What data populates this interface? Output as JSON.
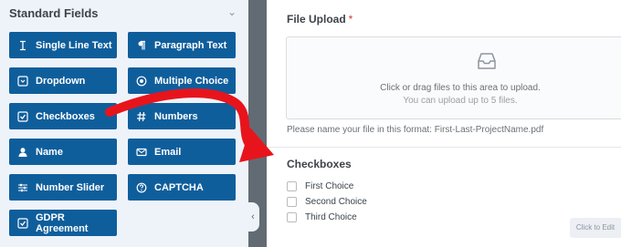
{
  "sidebar": {
    "section_title": "Standard Fields",
    "collapse_icon": "chevron-up-icon",
    "fields": [
      {
        "label": "Single Line Text",
        "icon": "text-cursor-icon"
      },
      {
        "label": "Paragraph Text",
        "icon": "paragraph-icon"
      },
      {
        "label": "Dropdown",
        "icon": "dropdown-icon"
      },
      {
        "label": "Multiple Choice",
        "icon": "radio-icon"
      },
      {
        "label": "Checkboxes",
        "icon": "checkbox-icon"
      },
      {
        "label": "Numbers",
        "icon": "hash-icon"
      },
      {
        "label": "Name",
        "icon": "user-icon"
      },
      {
        "label": "Email",
        "icon": "envelope-icon"
      },
      {
        "label": "Number Slider",
        "icon": "sliders-icon"
      },
      {
        "label": "CAPTCHA",
        "icon": "question-circle-icon"
      },
      {
        "label": "GDPR Agreement",
        "icon": "checkbox-icon"
      }
    ],
    "button_color": "#0f5e9c",
    "panel_bg": "#eef3f9"
  },
  "gutter": {
    "handle_icon": "chevron-left-icon",
    "color": "#626b74"
  },
  "form": {
    "file_upload": {
      "label": "File Upload",
      "required_mark": "*",
      "dropzone_icon": "inbox-icon",
      "dropzone_line1": "Click or drag files to this area to upload.",
      "dropzone_line2": "You can upload up to 5 files.",
      "helper": "Please name your file in this format: First-Last-ProjectName.pdf"
    },
    "checkboxes": {
      "label": "Checkboxes",
      "choices": [
        "First Choice",
        "Second Choice",
        "Third Choice"
      ]
    },
    "click_to_edit": "Click to Edit"
  },
  "annotation": {
    "arrow_color": "#e8141c"
  }
}
